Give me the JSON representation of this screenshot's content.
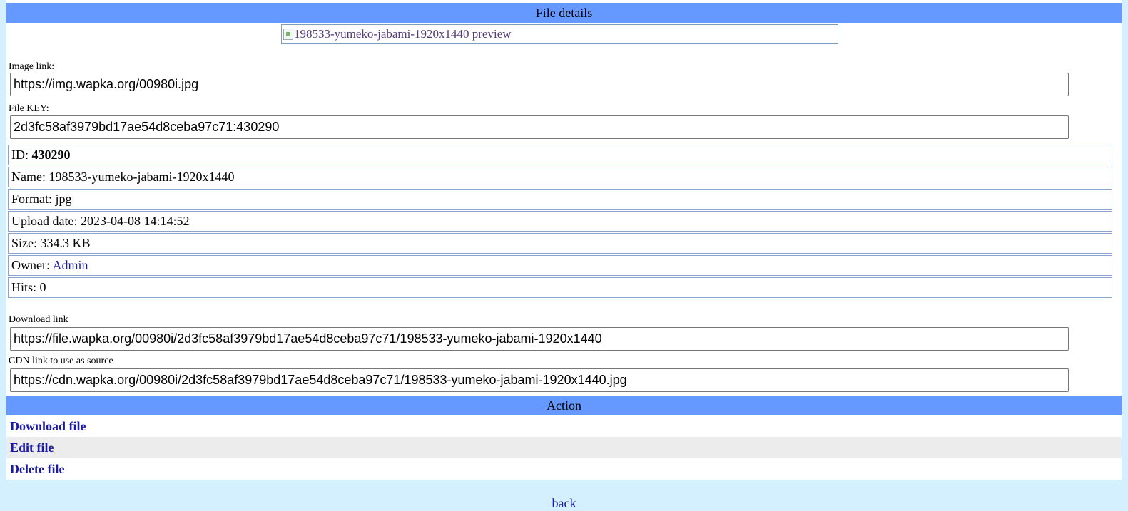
{
  "details": {
    "header": "File details",
    "preview_alt": "198533-yumeko-jabami-1920x1440 preview",
    "image_link_label": "Image link:",
    "image_link_value": "https://img.wapka.org/00980i.jpg",
    "file_key_label": "File KEY:",
    "file_key_value": "2d3fc58af3979bd17ae54d8ceba97c71:430290",
    "id_label": "ID: ",
    "id_value": "430290",
    "name_label": "Name: ",
    "name_value": "198533-yumeko-jabami-1920x1440",
    "format_label": "Format: ",
    "format_value": "jpg",
    "upload_label": "Upload date: ",
    "upload_value": "2023-04-08 14:14:52",
    "size_label": "Size: ",
    "size_value": "334.3 KB",
    "owner_label": "Owner: ",
    "owner_value": "Admin",
    "hits_label": "Hits: ",
    "hits_value": "0",
    "download_link_label": "Download link",
    "download_link_value": "https://file.wapka.org/00980i/2d3fc58af3979bd17ae54d8ceba97c71/198533-yumeko-jabami-1920x1440",
    "cdn_link_label": "CDN link to use as source",
    "cdn_link_value": "https://cdn.wapka.org/00980i/2d3fc58af3979bd17ae54d8ceba97c71/198533-yumeko-jabami-1920x1440.jpg"
  },
  "action": {
    "header": "Action",
    "download": "Download file",
    "edit": "Edit file",
    "delete": "Delete file"
  },
  "footer": {
    "back": "back"
  },
  "colors": {
    "background": "#d4f0ff",
    "header_bar": "#6699ff",
    "link": "#1a1aa6"
  }
}
